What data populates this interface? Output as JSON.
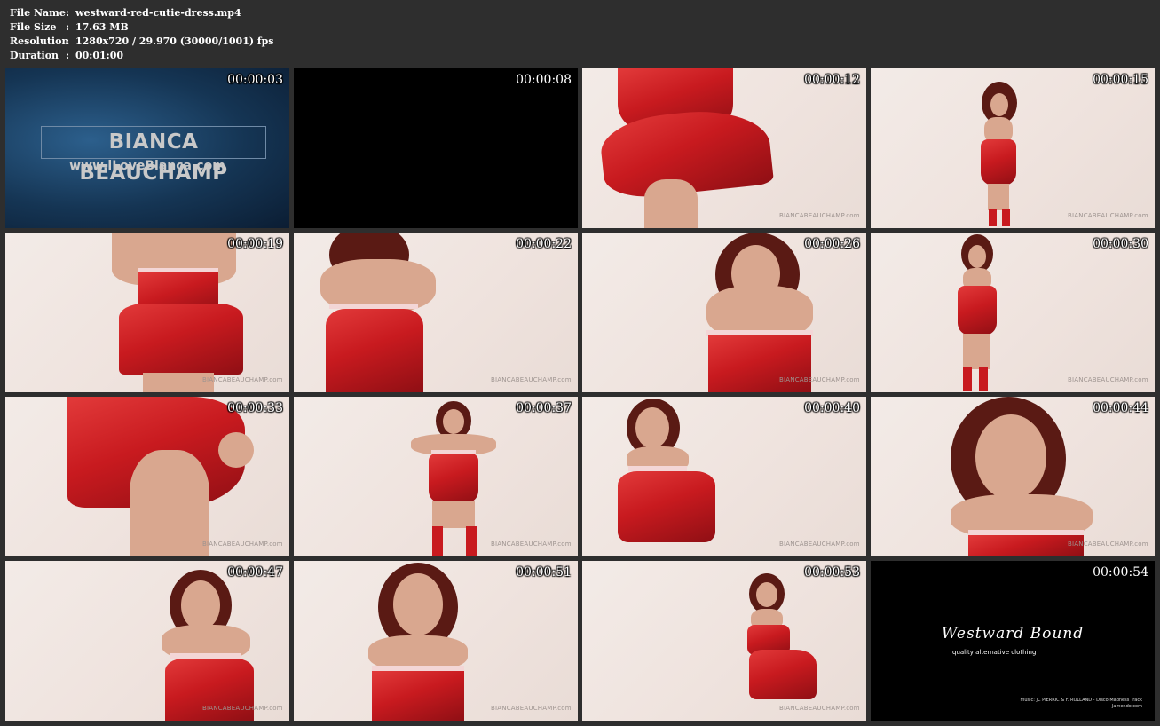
{
  "file_info": [
    {
      "key": "File Name",
      "sep": ":",
      "value": "westward-red-cutie-dress.mp4"
    },
    {
      "key": "File Size",
      "sep": ":",
      "value": "17.63 MB"
    },
    {
      "key": "Resolution",
      "sep": ":",
      "value": "1280x720 / 29.970 (30000/1001) fps"
    },
    {
      "key": "Duration",
      "sep": ":",
      "value": "00:01:00"
    }
  ],
  "watermark": "BIANCABEAUCHAMP.com",
  "intro": {
    "brand": "BIANCA BEAUCHAMP",
    "url": "www.iLoveBianca.com"
  },
  "outro": {
    "logo": "Westward Bound",
    "tagline": "quality alternative clothing",
    "music_line1": "music:  JC PIERRIC & F. ROLLAND - Disco Madness Track",
    "music_line2": "Jamendo.com"
  },
  "thumbnails": [
    {
      "timestamp": "00:00:03",
      "kind": "intro"
    },
    {
      "timestamp": "00:00:08",
      "kind": "black"
    },
    {
      "timestamp": "00:00:12",
      "kind": "frame"
    },
    {
      "timestamp": "00:00:15",
      "kind": "frame"
    },
    {
      "timestamp": "00:00:19",
      "kind": "frame"
    },
    {
      "timestamp": "00:00:22",
      "kind": "frame"
    },
    {
      "timestamp": "00:00:26",
      "kind": "frame"
    },
    {
      "timestamp": "00:00:30",
      "kind": "frame"
    },
    {
      "timestamp": "00:00:33",
      "kind": "frame"
    },
    {
      "timestamp": "00:00:37",
      "kind": "frame"
    },
    {
      "timestamp": "00:00:40",
      "kind": "frame"
    },
    {
      "timestamp": "00:00:44",
      "kind": "frame"
    },
    {
      "timestamp": "00:00:47",
      "kind": "frame"
    },
    {
      "timestamp": "00:00:51",
      "kind": "frame"
    },
    {
      "timestamp": "00:00:53",
      "kind": "frame"
    },
    {
      "timestamp": "00:00:54",
      "kind": "outro"
    }
  ]
}
